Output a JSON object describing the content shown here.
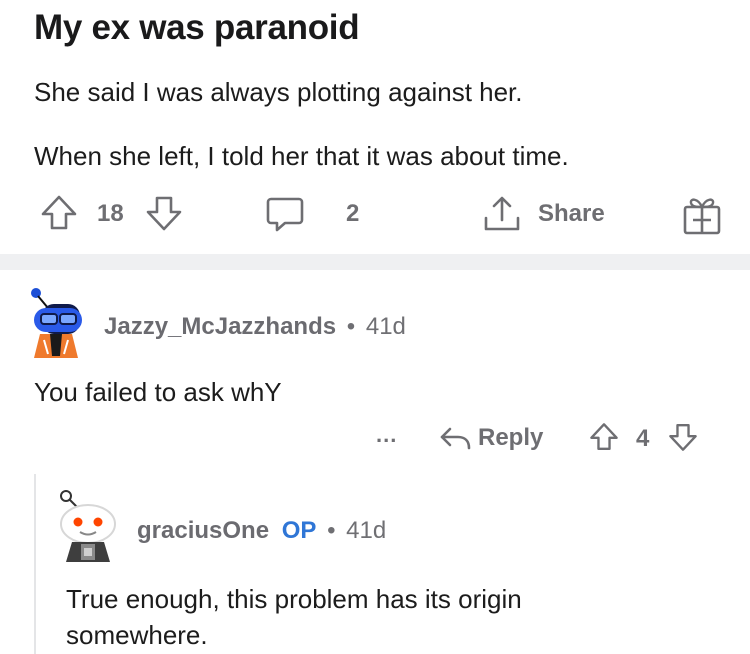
{
  "post": {
    "title": "My ex was paranoid",
    "paragraphs": [
      "She said I was always plotting against her.",
      "When she left, I told her that it was about time."
    ],
    "votes": "18",
    "comments": "2",
    "share_label": "Share"
  },
  "comments": [
    {
      "user": "Jazzy_McJazzhands",
      "separator": "•",
      "age": "41d",
      "text": "You failed to ask whY",
      "more": "...",
      "reply_label": "Reply",
      "votes": "4"
    },
    {
      "user": "graciusOne",
      "op_badge": "OP",
      "separator": "•",
      "age": "41d",
      "text": "True enough, this problem has its origin somewhere."
    }
  ],
  "icons": {
    "upvote": "upvote-arrow-icon",
    "downvote": "downvote-arrow-icon",
    "comment": "speech-bubble-icon",
    "share": "share-upload-icon",
    "award": "gift-award-icon",
    "reply": "reply-arrow-icon"
  },
  "colors": {
    "text": "#1a1a1b",
    "meta": "#6f6f73",
    "op": "#2f76d6",
    "divider": "#eff0f2"
  }
}
